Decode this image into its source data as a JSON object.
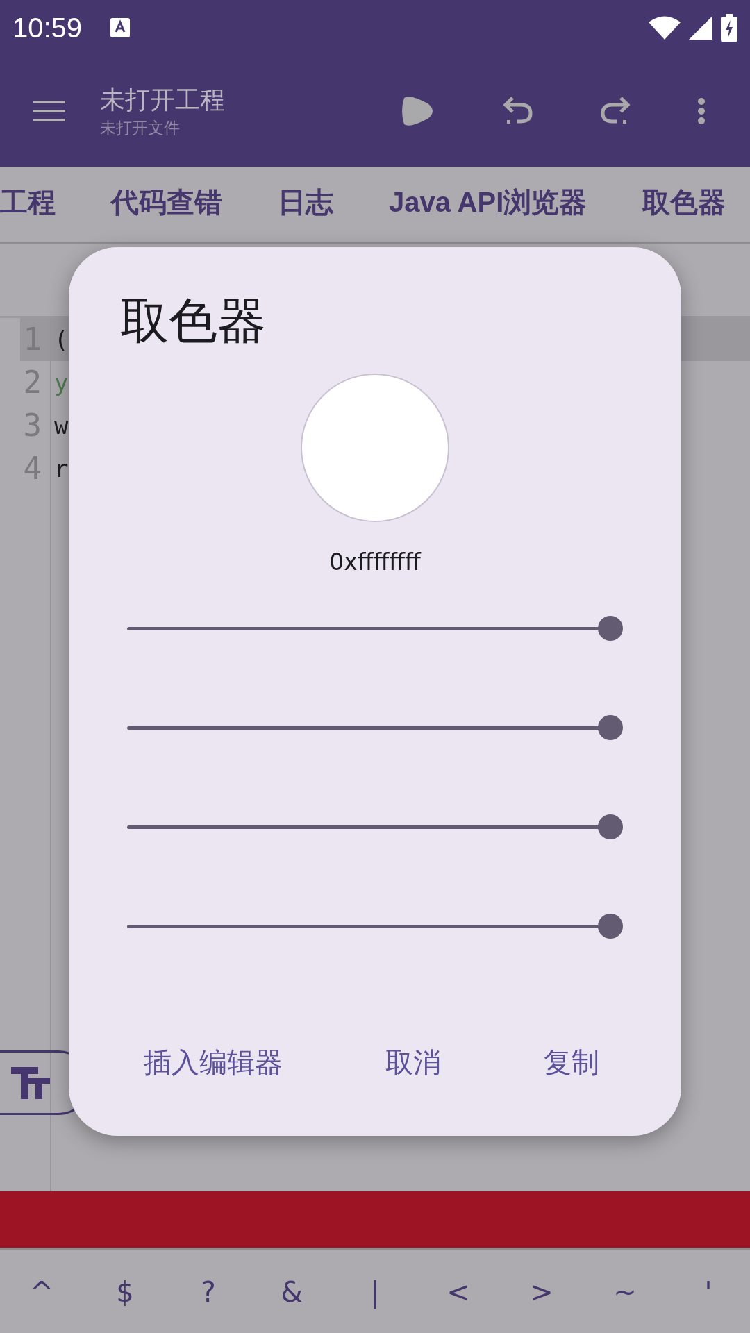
{
  "status_bar": {
    "time": "10:59"
  },
  "app_bar": {
    "title": "未打开工程",
    "subtitle": "未打开文件"
  },
  "tabs": [
    {
      "label": "工程",
      "selected": false
    },
    {
      "label": "代码查错",
      "selected": false
    },
    {
      "label": "日志",
      "selected": false
    },
    {
      "label": "Java API浏览器",
      "selected": false
    },
    {
      "label": "取色器",
      "selected": false
    }
  ],
  "editor": {
    "lines": [
      {
        "number": "1",
        "text": "(",
        "color": "#1c1b1f",
        "current": true
      },
      {
        "number": "2",
        "text": "y",
        "color": "#4f7a53",
        "current": false
      },
      {
        "number": "3",
        "text": "w",
        "color": "#1c1b1f",
        "current": false
      },
      {
        "number": "4",
        "text": "r",
        "color": "#1c1b1f",
        "current": false
      }
    ]
  },
  "dialog": {
    "title": "取色器",
    "color_hex": "0xffffffff",
    "sliders": [
      {
        "level": 1
      },
      {
        "level": 1
      },
      {
        "level": 1
      },
      {
        "level": 1
      }
    ],
    "buttons": [
      "插入编辑器",
      "取消",
      "复制"
    ]
  },
  "keys": [
    "^",
    "$",
    "?",
    "&",
    "|",
    "<",
    ">",
    "~",
    "'"
  ]
}
